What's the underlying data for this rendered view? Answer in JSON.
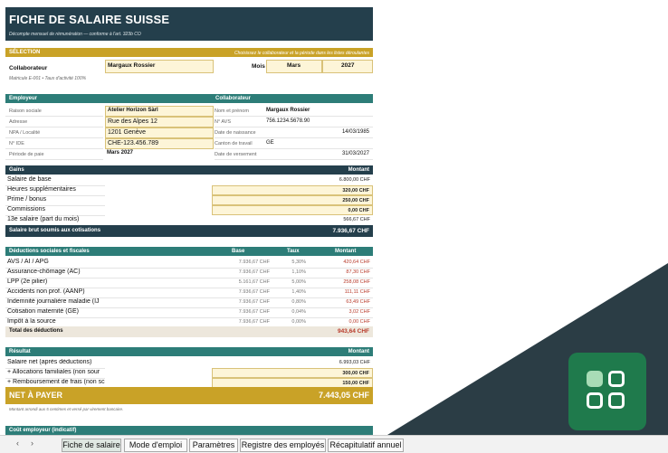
{
  "title": "FICHE DE SALAIRE SUISSE",
  "subtitle": "Décompte mensuel de rémunération — conforme à l'art. 323b CO",
  "selection": {
    "header": "SÉLECTION",
    "hint": "Choisissez le collaborateur et la période dans les listes déroulantes",
    "collab_label": "Collaborateur",
    "collab_value": "Margaux Rossier",
    "month_label": "Mois",
    "month_value": "Mars",
    "year_value": "2027",
    "matricule": "Matricule E-001  •  Taux d'activité 100%"
  },
  "employer": {
    "header": "Employeur",
    "rows": [
      {
        "label": "Raison sociale",
        "value": "Atelier Horizon Sàrl"
      },
      {
        "label": "Adresse",
        "value": "Rue des Alpes 12"
      },
      {
        "label": "NPA / Localité",
        "value": "1201 Genève"
      },
      {
        "label": "N° IDE",
        "value": "CHE-123.456.789"
      },
      {
        "label": "Période de paie",
        "value": "Mars 2027"
      }
    ]
  },
  "employee": {
    "header": "Collaborateur",
    "rows": [
      {
        "label": "Nom et prénom",
        "value": "Margaux Rossier"
      },
      {
        "label": "N° AVS",
        "value": "756.1234.5678.90"
      },
      {
        "label": "Date de naissance",
        "value": "14/03/1985"
      },
      {
        "label": "Canton de travail",
        "value": "GE"
      },
      {
        "label": "Date de versement",
        "value": "31/03/2027"
      }
    ]
  },
  "gains": {
    "header": "Gains",
    "amount_header": "Montant",
    "rows": [
      {
        "label": "Salaire de base",
        "amount": "6.800,00 CHF",
        "input": false
      },
      {
        "label": "Heures supplémentaires",
        "amount": "320,00 CHF",
        "input": true
      },
      {
        "label": "Prime / bonus",
        "amount": "250,00 CHF",
        "input": true
      },
      {
        "label": "Commissions",
        "amount": "0,00 CHF",
        "input": true
      },
      {
        "label": "13e salaire (part du mois)",
        "amount": "566,67 CHF",
        "input": false
      }
    ],
    "total_label": "Salaire brut soumis aux cotisations",
    "total_value": "7.936,67 CHF"
  },
  "deductions": {
    "header": "Déductions sociales et fiscales",
    "col_base": "Base",
    "col_rate": "Taux",
    "col_amount": "Montant",
    "rows": [
      {
        "label": "AVS / AI / APG",
        "base": "7.936,67 CHF",
        "rate": "5,30%",
        "amount": "420,64 CHF"
      },
      {
        "label": "Assurance-chômage (AC)",
        "base": "7.936,67 CHF",
        "rate": "1,10%",
        "amount": "87,30 CHF"
      },
      {
        "label": "LPP (2e pilier)",
        "base": "5.161,67 CHF",
        "rate": "5,00%",
        "amount": "258,08 CHF"
      },
      {
        "label": "Accidents non prof. (AANP)",
        "base": "7.936,67 CHF",
        "rate": "1,40%",
        "amount": "111,11 CHF"
      },
      {
        "label": "Indemnité journalière maladie (IJ",
        "base": "7.936,67 CHF",
        "rate": "0,80%",
        "amount": "63,49 CHF"
      },
      {
        "label": "Cotisation maternité (GE)",
        "base": "7.936,67 CHF",
        "rate": "0,04%",
        "amount": "3,02 CHF"
      },
      {
        "label": "Impôt à la source",
        "base": "7.936,67 CHF",
        "rate": "0,00%",
        "amount": "0,00 CHF"
      }
    ],
    "total_label": "Total des déductions",
    "total_value": "943,64 CHF"
  },
  "result": {
    "header": "Résultat",
    "amount_header": "Montant",
    "rows": [
      {
        "label": "Salaire net (après déductions)",
        "amount": "6.993,03 CHF",
        "input": false
      },
      {
        "label": "+ Allocations familiales (non sour",
        "amount": "300,00 CHF",
        "input": true
      },
      {
        "label": "+ Remboursement de frais (non sc",
        "amount": "150,00 CHF",
        "input": true
      }
    ],
    "net_label": "NET À PAYER",
    "net_value": "7.443,05 CHF",
    "note": "Montant arrondi aux 5 centimes et versé par virement bancaire."
  },
  "employer_cost_header": "Coût employeur (indicatif)",
  "tabs": [
    "Fiche de salaire",
    "Mode d'emploi",
    "Paramètres",
    "Registre des employés",
    "Récapitulatif annuel"
  ],
  "colors": {
    "navy": "#243f4c",
    "teal": "#2d7d78",
    "gold": "#c9a227",
    "input": "#fdf5d8",
    "icon": "#1f7a4c"
  }
}
